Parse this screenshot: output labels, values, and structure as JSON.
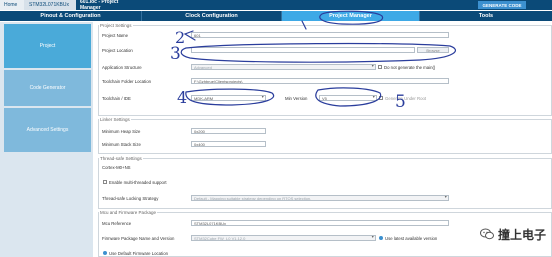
{
  "breadcrumb": {
    "home": "Home",
    "mcu": "STM32L071KBUx",
    "project": "601.ioc - Project Manager"
  },
  "header": {
    "generate_label": "GENERATE CODE"
  },
  "tabs": [
    {
      "label": "Pinout & Configuration"
    },
    {
      "label": "Clock Configuration"
    },
    {
      "label": "Project Manager"
    },
    {
      "label": "Tools"
    }
  ],
  "sidebar": {
    "items": [
      {
        "label": "Project"
      },
      {
        "label": "Code Generator"
      },
      {
        "label": "Advanced Settings"
      }
    ]
  },
  "project_settings": {
    "legend": "Project Settings",
    "name_label": "Project Name",
    "name_value": "601",
    "location_label": "Project Location",
    "location_value": "",
    "browse_label": "Browse",
    "app_structure_label": "Application Structure",
    "app_structure_value": "Advanced",
    "no_main_label": "Do not generate the main()",
    "toolchain_folder_label": "Toolchain Folder Location",
    "toolchain_folder_value": "F:\\Gzhbrue\\Clientsprojects\\",
    "toolchain_label": "Toolchain / IDE",
    "toolchain_value": "MDK-ARM",
    "min_version_label": "Min Version",
    "min_version_value": "V5",
    "generate_under_root_label": "Generate Under Root"
  },
  "linker_settings": {
    "legend": "Linker Settings",
    "heap_label": "Minimum Heap Size",
    "heap_value": "0x200",
    "stack_label": "Minimum Stack Size",
    "stack_value": "0x400"
  },
  "thread_settings": {
    "legend": "Thread-safe Settings",
    "sub_label": "Cortex-M0+NS",
    "enable_label": "Enable multi-threaded support",
    "strategy_label": "Thread-safe Locking Strategy",
    "strategy_value": "Default  -  Mapping suitable strategy depending on RTOS selection."
  },
  "mcu_settings": {
    "legend": "Mcu and Firmware Package",
    "ref_label": "Mcu Reference",
    "ref_value": "STM32L071KBUx",
    "fw_label": "Firmware Package Name and Version",
    "fw_value": "STM32Cube FW_L0 V1.12.0",
    "latest_label": "Use latest available version",
    "default_loc_label": "Use Default Firmware Location"
  },
  "annotations": {
    "n2": "2",
    "n3": "3",
    "n4": "4",
    "n5": "5"
  },
  "watermark": {
    "text": "撞上电子"
  },
  "colors": {
    "nav": "#0b4a78",
    "active_tab": "#3ea9e6",
    "ink": "#2a3d9c"
  }
}
